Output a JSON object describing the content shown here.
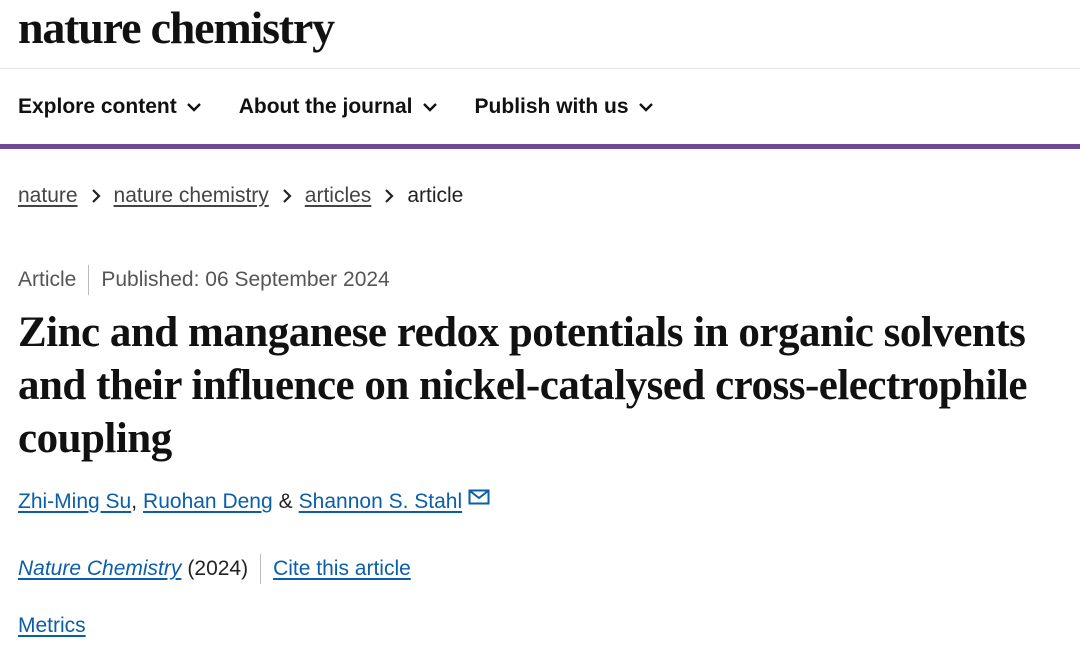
{
  "header": {
    "logo": "nature chemistry"
  },
  "nav": {
    "items": [
      {
        "label": "Explore content"
      },
      {
        "label": "About the journal"
      },
      {
        "label": "Publish with us"
      }
    ],
    "accent_color": "#6c4a96"
  },
  "breadcrumb": [
    "nature",
    "nature chemistry",
    "articles",
    "article"
  ],
  "article": {
    "type": "Article",
    "published": "Published: 06 September 2024",
    "title": "Zinc and manganese redox potentials in organic solvents and their influence on nickel-catalysed cross-electrophile coupling",
    "authors": [
      "Zhi-Ming Su",
      "Ruohan Deng",
      "Shannon S. Stahl"
    ],
    "author_sep_1": ",",
    "author_sep_2": "&",
    "journal": "Nature Chemistry",
    "year": "(2024)",
    "cite": "Cite this article",
    "metrics": "Metrics"
  },
  "colors": {
    "link": "#0b5ea8",
    "text": "#222222"
  }
}
